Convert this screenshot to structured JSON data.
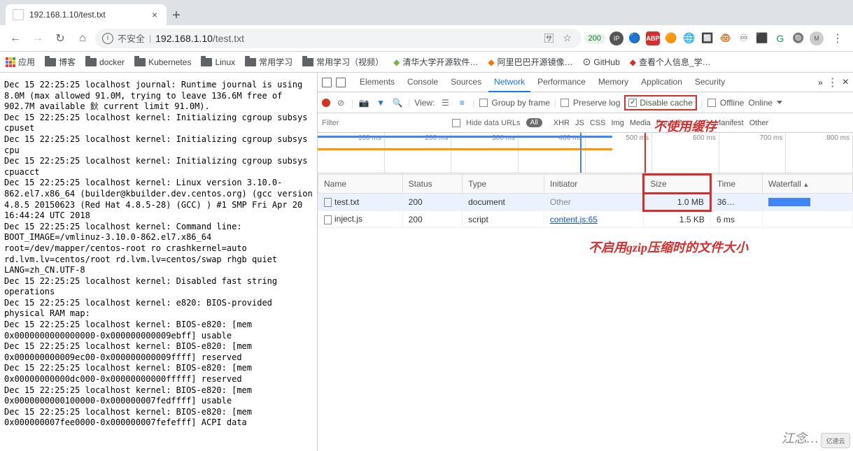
{
  "browser": {
    "tab_title": "192.168.1.10/test.txt",
    "insecure_label": "不安全",
    "url_host": "192.168.1.10",
    "url_path": "/test.txt",
    "badge_200": "200"
  },
  "bookmarks": [
    {
      "icon": "apps",
      "label": "应用"
    },
    {
      "icon": "folder",
      "label": "博客"
    },
    {
      "icon": "folder",
      "label": "docker"
    },
    {
      "icon": "folder",
      "label": "Kubernetes"
    },
    {
      "icon": "folder",
      "label": "Linux"
    },
    {
      "icon": "folder",
      "label": "常用学习"
    },
    {
      "icon": "folder",
      "label": "常用学习（视频）"
    },
    {
      "icon": "ext",
      "label": "清华大学开源软件…"
    },
    {
      "icon": "ext2",
      "label": "阿里巴巴开源镜像…"
    },
    {
      "icon": "github",
      "label": "GitHub"
    },
    {
      "icon": "ext3",
      "label": "查看个人信息_学…"
    }
  ],
  "page_text": "Dec 15 22:25:25 localhost journal: Runtime journal is using 8.0M (max allowed 91.0M, trying to leave 136.6M free of 902.7M available 鈥 current limit 91.0M).\nDec 15 22:25:25 localhost kernel: Initializing cgroup subsys cpuset\nDec 15 22:25:25 localhost kernel: Initializing cgroup subsys cpu\nDec 15 22:25:25 localhost kernel: Initializing cgroup subsys cpuacct\nDec 15 22:25:25 localhost kernel: Linux version 3.10.0-862.el7.x86_64 (builder@kbuilder.dev.centos.org) (gcc version 4.8.5 20150623 (Red Hat 4.8.5-28) (GCC) ) #1 SMP Fri Apr 20 16:44:24 UTC 2018\nDec 15 22:25:25 localhost kernel: Command line: BOOT_IMAGE=/vmlinuz-3.10.0-862.el7.x86_64 root=/dev/mapper/centos-root ro crashkernel=auto rd.lvm.lv=centos/root rd.lvm.lv=centos/swap rhgb quiet LANG=zh_CN.UTF-8\nDec 15 22:25:25 localhost kernel: Disabled fast string operations\nDec 15 22:25:25 localhost kernel: e820: BIOS-provided physical RAM map:\nDec 15 22:25:25 localhost kernel: BIOS-e820: [mem 0x0000000000000000-0x000000000009ebff] usable\nDec 15 22:25:25 localhost kernel: BIOS-e820: [mem 0x000000000009ec00-0x000000000009ffff] reserved\nDec 15 22:25:25 localhost kernel: BIOS-e820: [mem 0x00000000000dc000-0x00000000000fffff] reserved\nDec 15 22:25:25 localhost kernel: BIOS-e820: [mem 0x0000000000100000-0x000000007fedffff] usable\nDec 15 22:25:25 localhost kernel: BIOS-e820: [mem 0x000000007fee0000-0x000000007fefefff] ACPI data",
  "devtools": {
    "tabs": [
      "Elements",
      "Console",
      "Sources",
      "Network",
      "Performance",
      "Memory",
      "Application",
      "Security"
    ],
    "active_tab": "Network",
    "more_tabs": "»",
    "view_label": "View:",
    "group_by_frame": "Group by frame",
    "preserve_log": "Preserve log",
    "disable_cache": "Disable cache",
    "offline": "Offline",
    "online": "Online",
    "filter_placeholder": "Filter",
    "hide_data_urls": "Hide data URLs",
    "filter_all": "All",
    "filter_types": [
      "XHR",
      "JS",
      "CSS",
      "Img",
      "Media",
      "Font",
      "Doc",
      "WS",
      "Manifest",
      "Other"
    ],
    "timeline_ticks": [
      "100 ms",
      "200 ms",
      "300 ms",
      "400 ms",
      "500 ms",
      "600 ms",
      "700 ms",
      "800 ms"
    ],
    "columns": [
      "Name",
      "Status",
      "Type",
      "Initiator",
      "Size",
      "Time",
      "Waterfall"
    ],
    "rows": [
      {
        "name": "test.txt",
        "status": "200",
        "type": "document",
        "initiator": "Other",
        "initiator_link": false,
        "size": "1.0 MB",
        "time": "36…",
        "selected": true,
        "size_hl": true
      },
      {
        "name": "inject.js",
        "status": "200",
        "type": "script",
        "initiator": "content.js:65",
        "initiator_link": true,
        "size": "1.5 KB",
        "time": "6 ms",
        "selected": false,
        "size_hl": false
      }
    ]
  },
  "annotations": {
    "annot1": "不使用缓存",
    "annot2": "不启用gzip压缩时的文件大小",
    "watermark": "江念…",
    "logo": "亿速云"
  }
}
